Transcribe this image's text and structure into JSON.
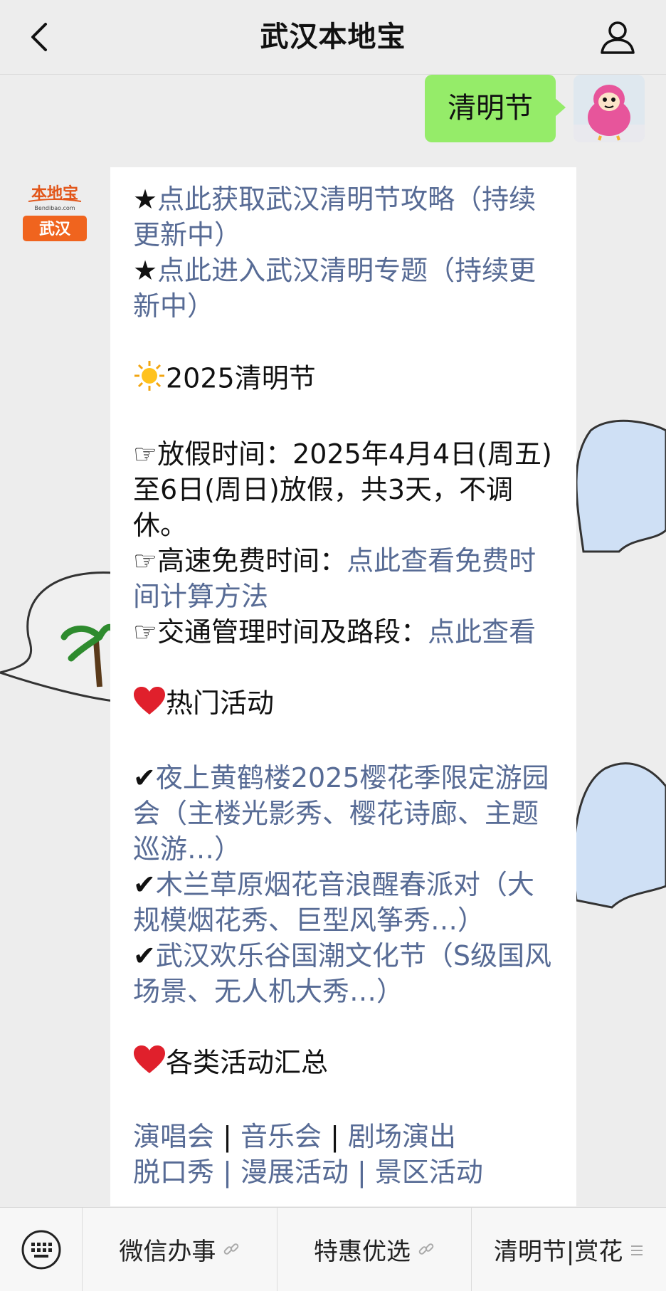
{
  "header": {
    "title": "武汉本地宝"
  },
  "outgoing": {
    "text": "清明节"
  },
  "bot": {
    "logo_top": "本地宝",
    "logo_sub": "Bendibao.com",
    "logo_city": "武汉"
  },
  "message": {
    "star": "★",
    "line1": "点此获取武汉清明节攻略（持续更新中）",
    "line2": "点此进入武汉清明专题（持续更新中）",
    "holiday_title": "2025清明节",
    "holiday_label": "放假时间：",
    "holiday_text": "2025年4月4日(周五)至6日(周日)放假，共3天，不调休。",
    "highway_label": "高速免费时间：",
    "highway_link": "点此查看免费时间计算方法",
    "traffic_label": "交通管理时间及路段：",
    "traffic_link": "点此查看",
    "hot_title": "热门活动",
    "check": "✔",
    "act1": "夜上黄鹤楼2025樱花季限定游园会（主楼光影秀、樱花诗廊、主题巡游…）",
    "act2": "木兰草原烟花音浪醒春派对（大规模烟花秀、巨型风筝秀…）",
    "act3": "武汉欢乐谷国潮文化节（S级国风场景、无人机大秀…）",
    "all_title": "各类活动汇总",
    "cat1": "演唱会",
    "cat2": "音乐会",
    "cat3": "剧场演出",
    "sep": "|",
    "partial": "脱口秀 | 漫展活动 | 景区活动"
  },
  "menu": {
    "item1": "微信办事",
    "item2": "特惠优选",
    "item3": "清明节|赏花"
  },
  "colors": {
    "link": "#576b95",
    "outgoing_bubble": "#95ec69",
    "logo_orange": "#f0641e"
  }
}
